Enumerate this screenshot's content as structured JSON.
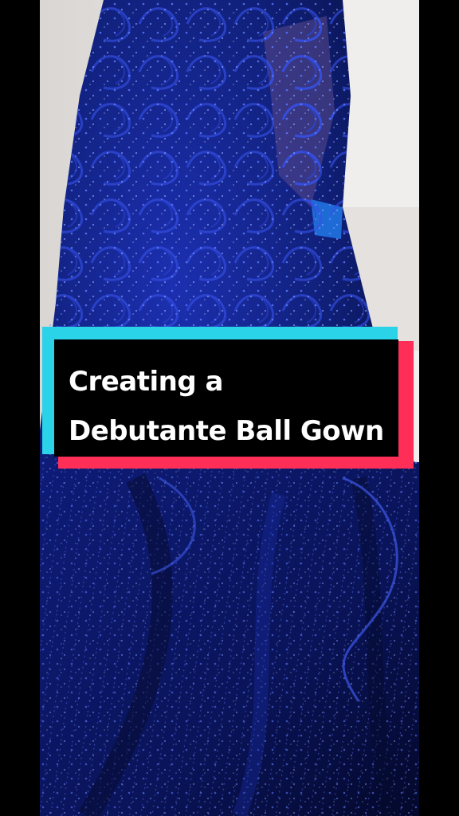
{
  "caption": {
    "line1": "Creating a",
    "line2": "Debutante Ball Gown"
  },
  "scene": {
    "subject": "navy-beaded-ball-gown-photo"
  },
  "colors": {
    "letterbox": "#000000",
    "caption_cyan": "#2ad3e8",
    "caption_red": "#ff2e57",
    "caption_box": "#000000",
    "caption_text": "#ffffff",
    "gown_navy": "#0d1a6b",
    "wall": "#e6e3df"
  }
}
